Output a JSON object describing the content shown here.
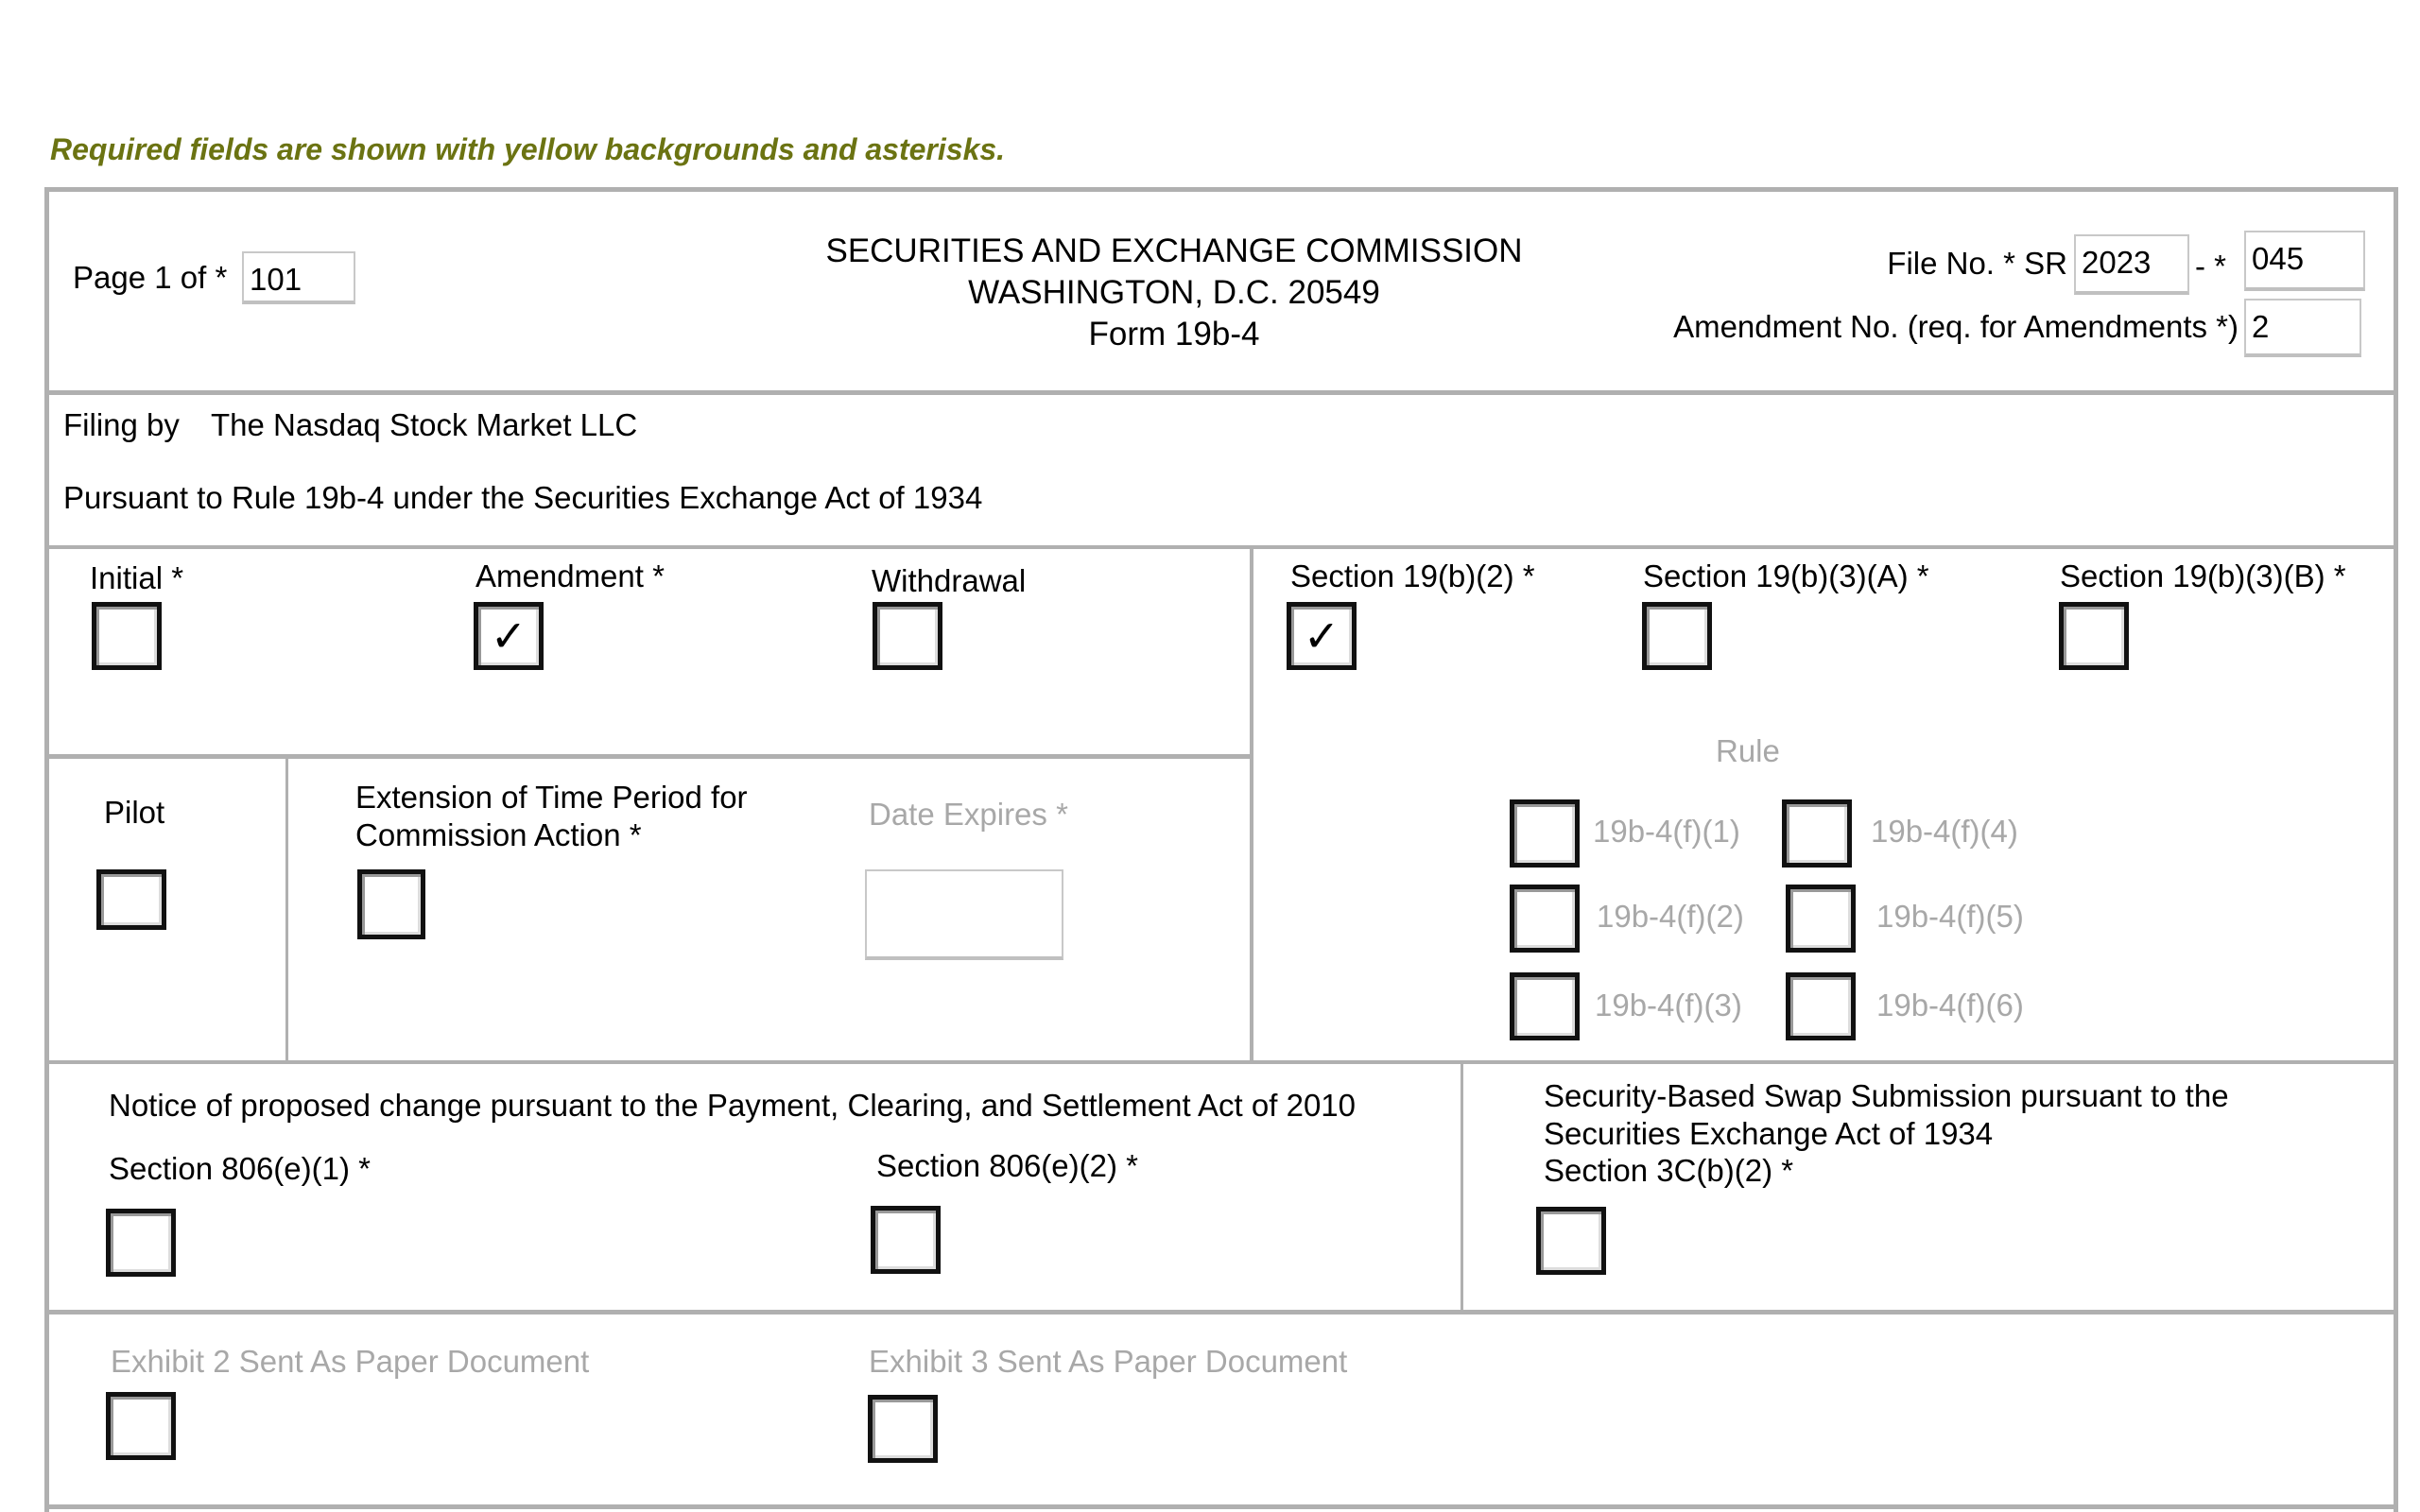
{
  "notice": "Required fields are shown with yellow backgrounds and asterisks.",
  "header": {
    "page_label": "Page 1 of *",
    "page_total": "101",
    "title_lines": [
      "SECURITIES AND EXCHANGE COMMISSION",
      "WASHINGTON, D.C. 20549",
      "Form 19b-4"
    ],
    "file_no_label": "File No. * SR",
    "file_no_year": "2023",
    "file_no_sep": "- *",
    "file_no_number": "045",
    "amendment_label": "Amendment No. (req. for Amendments *)",
    "amendment_value": "2"
  },
  "filing": {
    "filing_by_label": "Filing by",
    "filer": "The Nasdaq Stock Market LLC",
    "pursuant": "Pursuant to Rule 19b-4 under the Securities Exchange Act of 1934"
  },
  "filing_type": [
    {
      "label": "Initial *",
      "checked": false
    },
    {
      "label": "Amendment *",
      "checked": true
    },
    {
      "label": "Withdrawal",
      "checked": false
    }
  ],
  "sections": [
    {
      "label": "Section 19(b)(2) *",
      "checked": true
    },
    {
      "label": "Section 19(b)(3)(A) *",
      "checked": false
    },
    {
      "label": "Section 19(b)(3)(B) *",
      "checked": false
    }
  ],
  "pilot": {
    "label": "Pilot",
    "checked": false
  },
  "extension": {
    "label_line1": "Extension of Time Period for",
    "label_line2": "Commission Action *",
    "checked": false
  },
  "date_expires": {
    "label": "Date Expires *",
    "value": ""
  },
  "rule": {
    "label": "Rule",
    "options": [
      "19b-4(f)(1)",
      "19b-4(f)(2)",
      "19b-4(f)(3)",
      "19b-4(f)(4)",
      "19b-4(f)(5)",
      "19b-4(f)(6)"
    ],
    "check_mark": "✓"
  },
  "pcs": {
    "notice": "Notice of proposed change pursuant to the Payment, Clearing, and Settlement Act of 2010",
    "s1": "Section 806(e)(1) *",
    "s2": "Section 806(e)(2) *"
  },
  "swap": {
    "line1": "Security-Based Swap Submission pursuant to the",
    "line2": "Securities Exchange Act of 1934",
    "line3": "Section 3C(b)(2) *"
  },
  "exhibits": {
    "e2": "Exhibit 2 Sent As Paper Document",
    "e3": "Exhibit 3 Sent As Paper Document"
  },
  "colors": {
    "notice": "#6b7312",
    "border": "#b0b0b0",
    "disabled_text": "#a8a8a8"
  }
}
